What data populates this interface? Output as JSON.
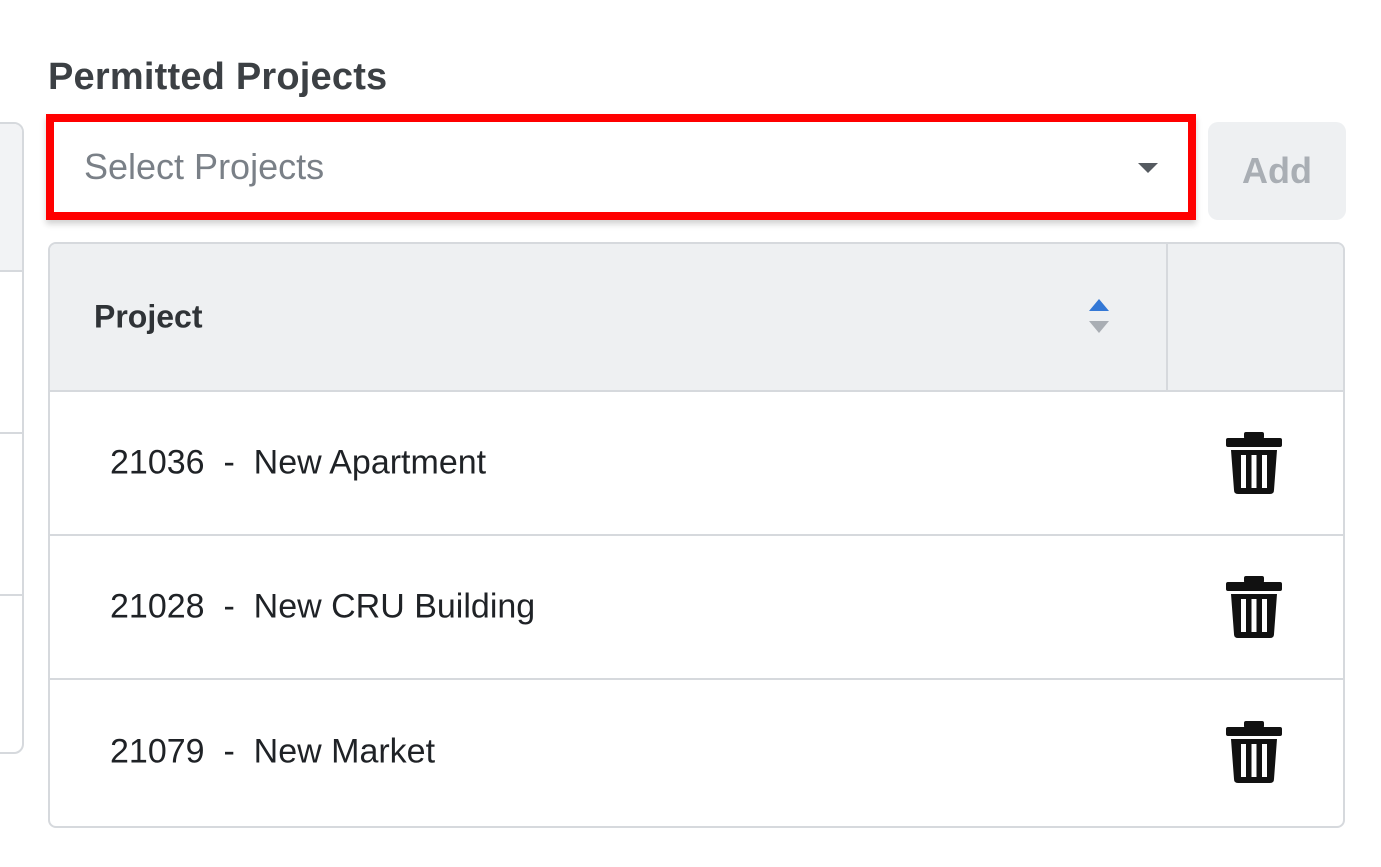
{
  "section": {
    "title": "Permitted Projects"
  },
  "select": {
    "placeholder": "Select Projects",
    "caret_icon": "caret-down-icon"
  },
  "add_button": {
    "label": "Add"
  },
  "table": {
    "columns": [
      {
        "label": "Project",
        "sort_icon": "sort-icon"
      },
      {
        "label": ""
      }
    ],
    "rows": [
      {
        "project": "21036  -  New Apartment",
        "action_icon": "trash-icon"
      },
      {
        "project": "21028  -  New CRU Building",
        "action_icon": "trash-icon"
      },
      {
        "project": "21079  -  New Market",
        "action_icon": "trash-icon"
      }
    ]
  },
  "colors": {
    "highlight_border": "#ff0000",
    "sort_active": "#3478d6",
    "sort_inactive": "#a9aeb4",
    "header_bg": "#eef0f2",
    "border": "#d6d9dd"
  }
}
